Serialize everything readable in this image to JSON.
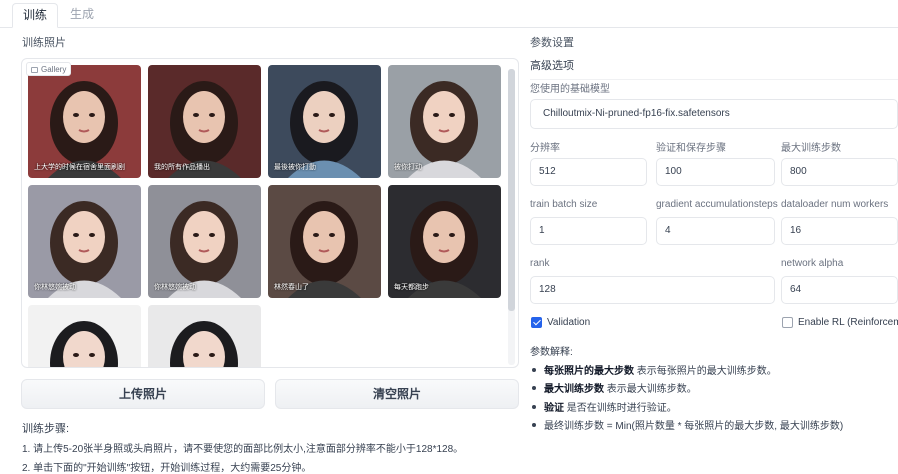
{
  "tabs": [
    {
      "label": "训练",
      "active": true
    },
    {
      "label": "生成",
      "active": false
    }
  ],
  "left": {
    "photos_label": "训练照片",
    "gallery_badge": "Gallery",
    "gallery_scroll_position": 0,
    "thumbnails": [
      {
        "caption": "上大学的时候在宿舍里面刷剧",
        "bg": "#8c3b3b",
        "tone": "dark"
      },
      {
        "caption": "我的所有作品播出",
        "bg": "#5a2a2a",
        "tone": "dark"
      },
      {
        "caption": "最後被你打動",
        "bg": "#3d4a5c",
        "tone": "blue"
      },
      {
        "caption": "被你打动",
        "bg": "#9aa0a6",
        "tone": "light"
      },
      {
        "caption": "你林悠婉被动",
        "bg": "#9a9aa6",
        "tone": "light"
      },
      {
        "caption": "你林悠婉被动",
        "bg": "#8f9098",
        "tone": "light"
      },
      {
        "caption": "林然春山了",
        "bg": "#5b4a44",
        "tone": "dark"
      },
      {
        "caption": "每天都跑步",
        "bg": "#2c2c30",
        "tone": "dark"
      },
      {
        "caption": "",
        "bg": "#f2f2f2",
        "tone": "white"
      },
      {
        "caption": "",
        "bg": "#e9e9ea",
        "tone": "white"
      }
    ],
    "upload_button": "上传照片",
    "clear_button": "清空照片",
    "steps_title": "训练步骤:",
    "steps": [
      "1. 请上传5-20张半身照或头肩照片，请不要使您的面部比例太小,注意面部分辨率不能小于128*128。",
      "2. 单击下面的\"开始训练\"按钮，开始训练过程，大约需要25分钟。"
    ]
  },
  "right": {
    "settings_label": "参数设置",
    "advanced_label": "高级选项",
    "base_model_label": "您使用的基础模型",
    "base_model_value": "Chilloutmix-Ni-pruned-fp16-fix.safetensors",
    "fields": {
      "resolution": {
        "label": "分辨率",
        "value": "512"
      },
      "val_save_steps": {
        "label": "验证和保存步骤",
        "value": "100"
      },
      "max_train_steps": {
        "label": "最大训练步数",
        "value": "800"
      },
      "train_batch_size": {
        "label": "train batch size",
        "value": "1"
      },
      "grad_accum": {
        "label": "gradient accumulationsteps",
        "value": "4"
      },
      "num_workers": {
        "label": "dataloader num workers",
        "value": "16"
      },
      "rank": {
        "label": "rank",
        "value": "128"
      },
      "network_alpha": {
        "label": "network alpha",
        "value": "64"
      }
    },
    "validation": {
      "label": "Validation",
      "checked": true
    },
    "enable_rl": {
      "label": "Enable RL (Reinforcemen",
      "checked": false
    },
    "notes_title": "参数解释:",
    "notes": [
      {
        "bold": "每张照片的最大步数",
        "text": " 表示每张照片的最大训练步数。"
      },
      {
        "bold": "最大训练步数",
        "text": " 表示最大训练步数。"
      },
      {
        "bold": "验证",
        "text": " 是否在训练时进行验证。"
      },
      {
        "bold": "",
        "text": "最终训练步数 = Min(照片数量 * 每张照片的最大步数, 最大训练步数)"
      }
    ]
  },
  "colors": {
    "accent": "#2563eb",
    "border": "#e5e7eb",
    "text": "#374151",
    "muted": "#6b7280"
  }
}
